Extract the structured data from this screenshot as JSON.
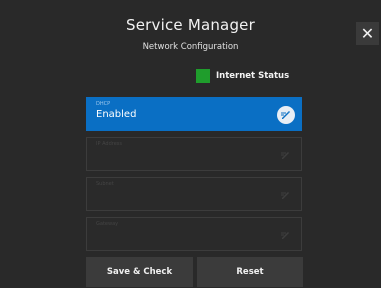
{
  "header": {
    "title": "Service Manager",
    "subtitle": "Network Configuration",
    "close_label": "✕"
  },
  "status": {
    "label": "Internet Status",
    "color": "#1f9d2c"
  },
  "fields": [
    {
      "label": "DHCP",
      "value": "Enabled",
      "active": true,
      "icon": "edit-icon"
    },
    {
      "label": "IP Address",
      "value": "",
      "active": false,
      "icon": "edit-icon"
    },
    {
      "label": "Subnet",
      "value": "",
      "active": false,
      "icon": "edit-icon"
    },
    {
      "label": "Gateway",
      "value": "",
      "active": false,
      "icon": "edit-icon"
    }
  ],
  "actions": {
    "save_check_label": "Save & Check",
    "reset_label": "Reset"
  },
  "colors": {
    "accent": "#0a6fc4",
    "background": "#292929"
  }
}
